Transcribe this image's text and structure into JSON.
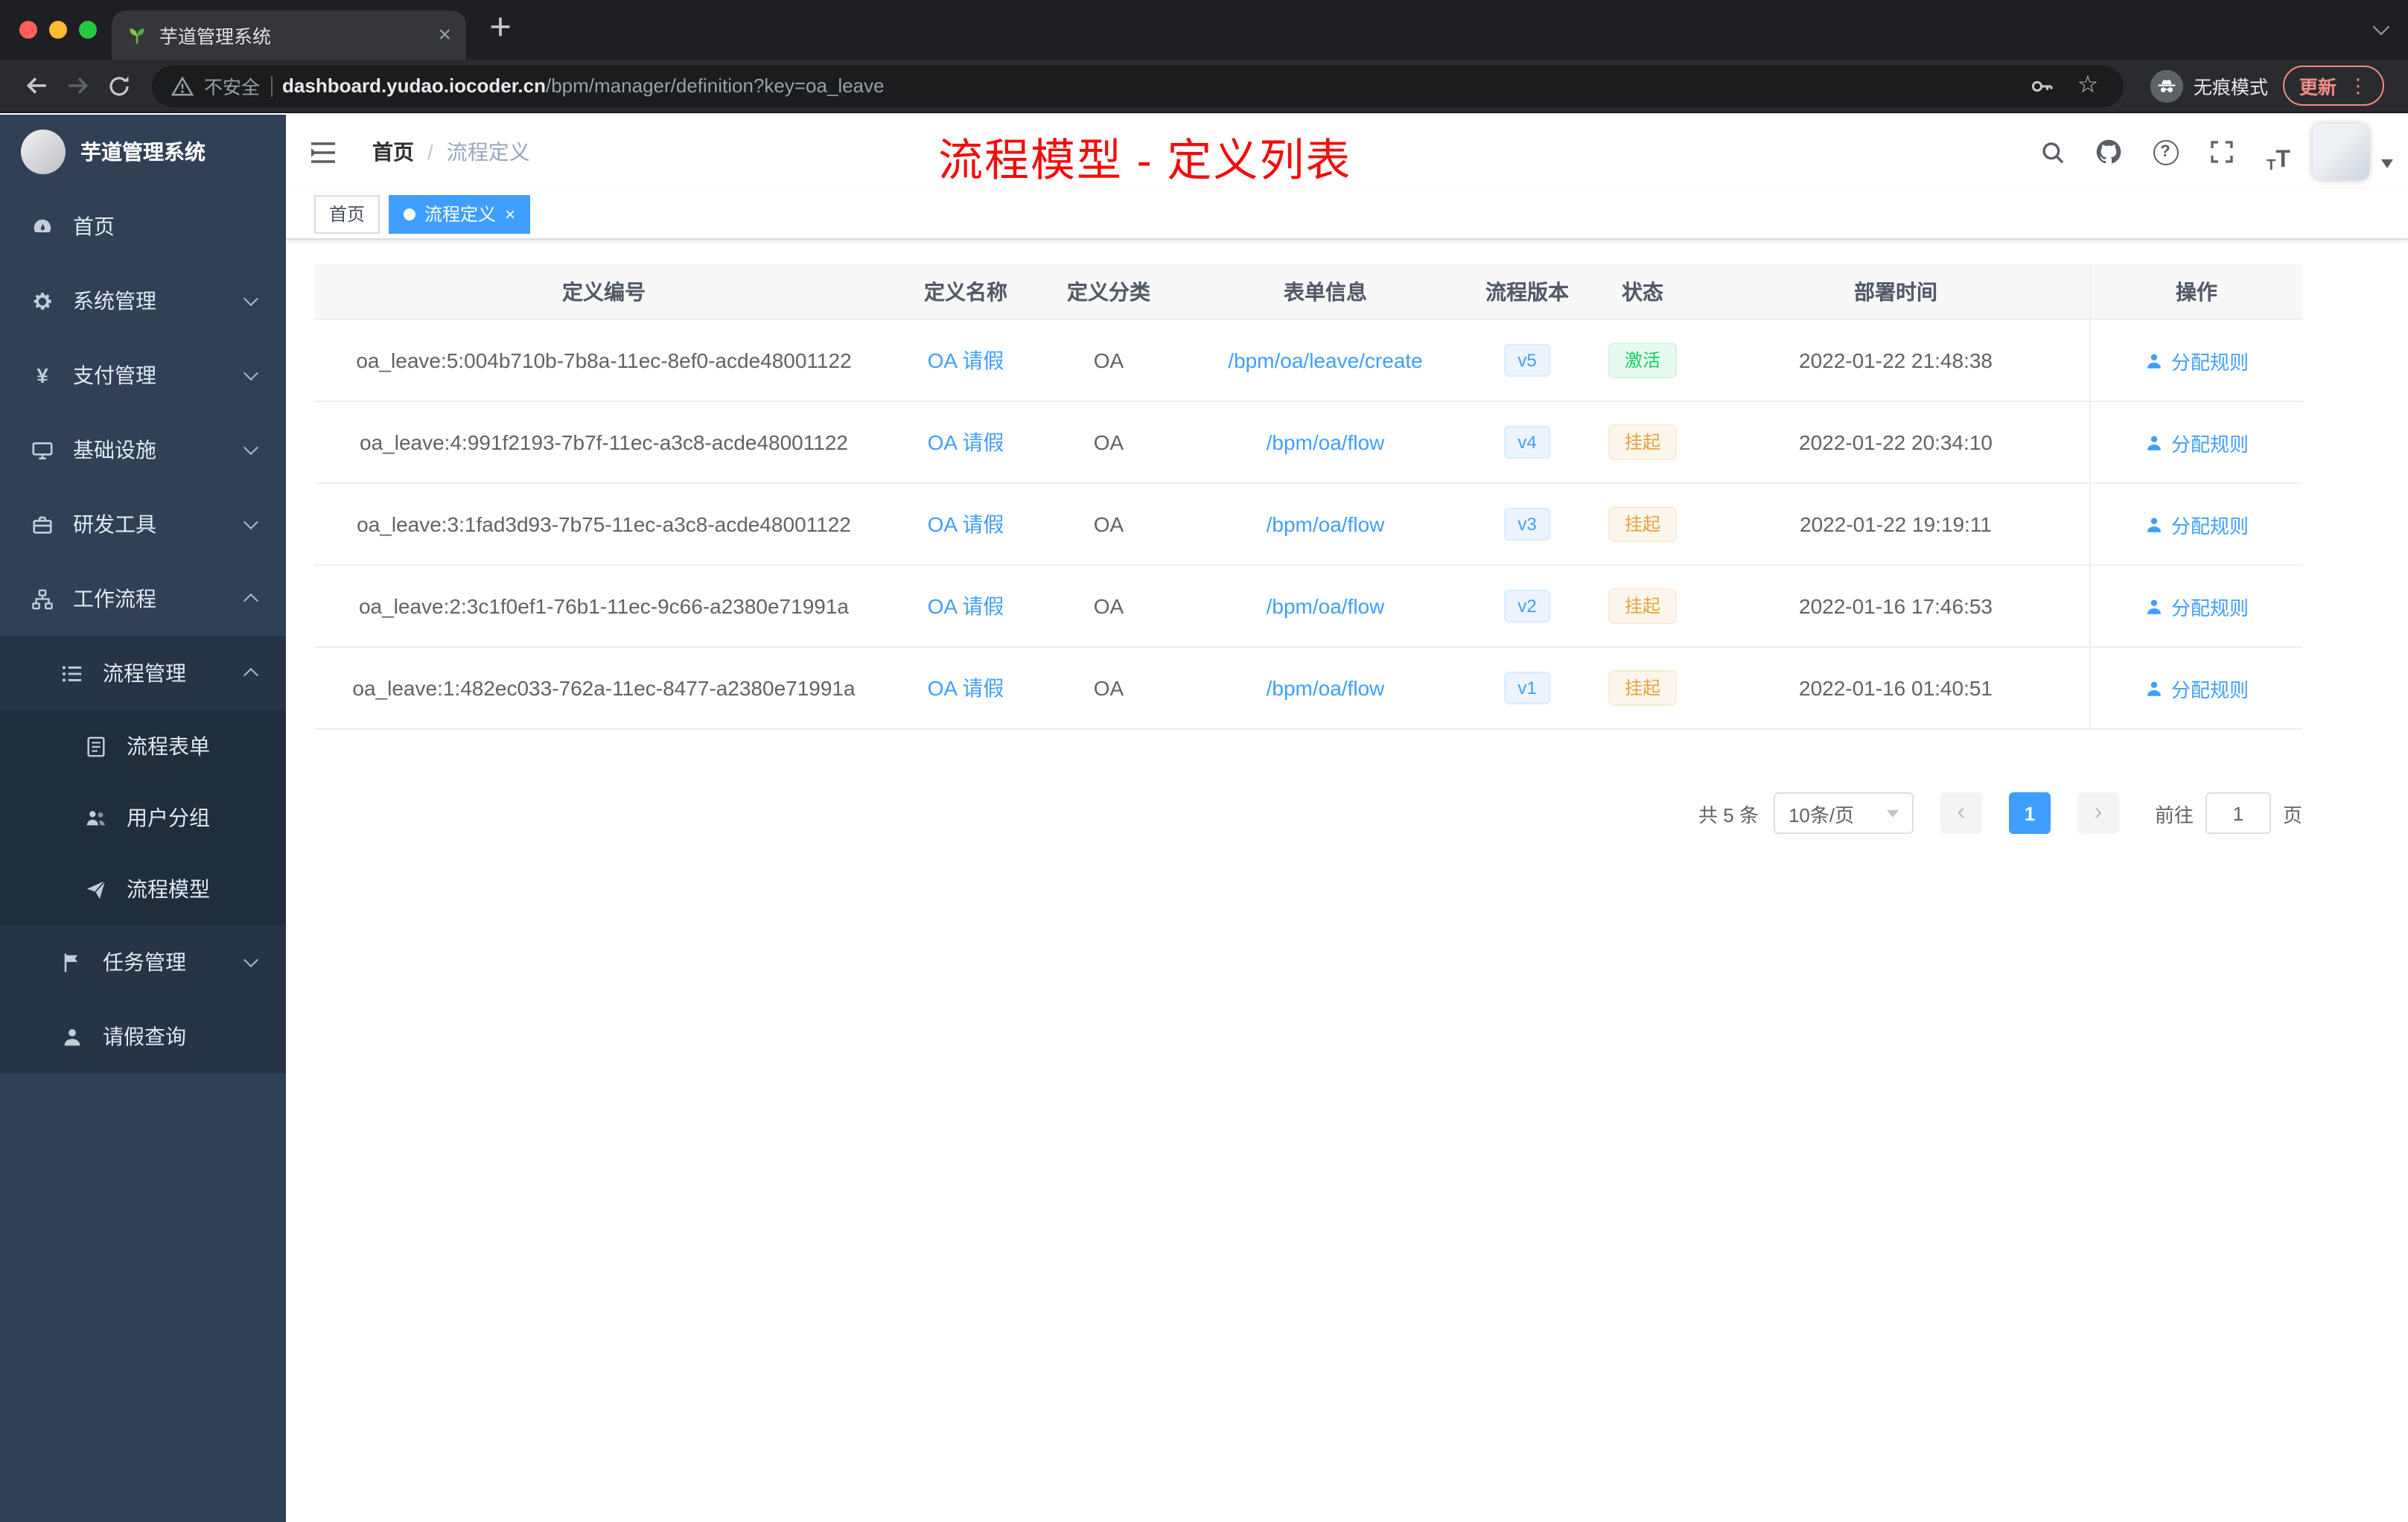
{
  "browser": {
    "tab_title": "芋道管理系统",
    "security_label": "不安全",
    "url_host": "dashboard.yudao.iocoder.cn",
    "url_path": "/bpm/manager/definition?key=oa_leave",
    "incognito_label": "无痕模式",
    "update_label": "更新"
  },
  "sidebar": {
    "logo_title": "芋道管理系统",
    "items": [
      {
        "label": "首页"
      },
      {
        "label": "系统管理"
      },
      {
        "label": "支付管理"
      },
      {
        "label": "基础设施"
      },
      {
        "label": "研发工具"
      },
      {
        "label": "工作流程"
      },
      {
        "label": "流程管理"
      },
      {
        "label": "流程表单"
      },
      {
        "label": "用户分组"
      },
      {
        "label": "流程模型"
      },
      {
        "label": "任务管理"
      },
      {
        "label": "请假查询"
      }
    ]
  },
  "header": {
    "breadcrumb_home": "首页",
    "breadcrumb_separator": "/",
    "breadcrumb_current": "流程定义",
    "annotation": "流程模型 - 定义列表"
  },
  "tags": {
    "home": "首页",
    "active": "流程定义"
  },
  "table": {
    "columns": [
      "定义编号",
      "定义名称",
      "定义分类",
      "表单信息",
      "流程版本",
      "状态",
      "部署时间",
      "操作"
    ],
    "rows": [
      {
        "id": "oa_leave:5:004b710b-7b8a-11ec-8ef0-acde48001122",
        "name": "OA 请假",
        "category": "OA",
        "form": "/bpm/oa/leave/create",
        "version": "v5",
        "status": "激活",
        "time": "2022-01-22 21:48:38",
        "action": "分配规则"
      },
      {
        "id": "oa_leave:4:991f2193-7b7f-11ec-a3c8-acde48001122",
        "name": "OA 请假",
        "category": "OA",
        "form": "/bpm/oa/flow",
        "version": "v4",
        "status": "挂起",
        "time": "2022-01-22 20:34:10",
        "action": "分配规则"
      },
      {
        "id": "oa_leave:3:1fad3d93-7b75-11ec-a3c8-acde48001122",
        "name": "OA 请假",
        "category": "OA",
        "form": "/bpm/oa/flow",
        "version": "v3",
        "status": "挂起",
        "time": "2022-01-22 19:19:11",
        "action": "分配规则"
      },
      {
        "id": "oa_leave:2:3c1f0ef1-76b1-11ec-9c66-a2380e71991a",
        "name": "OA 请假",
        "category": "OA",
        "form": "/bpm/oa/flow",
        "version": "v2",
        "status": "挂起",
        "time": "2022-01-16 17:46:53",
        "action": "分配规则"
      },
      {
        "id": "oa_leave:1:482ec033-762a-11ec-8477-a2380e71991a",
        "name": "OA 请假",
        "category": "OA",
        "form": "/bpm/oa/flow",
        "version": "v1",
        "status": "挂起",
        "time": "2022-01-16 01:40:51",
        "action": "分配规则"
      }
    ]
  },
  "pagination": {
    "total": "共 5 条",
    "page_size": "10条/页",
    "page": "1",
    "goto_label": "前往",
    "goto_value": "1",
    "page_unit": "页"
  },
  "colors": {
    "accent": "#409eff",
    "success": "#13ce66",
    "warning": "#e6a23c",
    "annotation_red": "#f20d0d",
    "sidebar_bg": "#304156"
  }
}
